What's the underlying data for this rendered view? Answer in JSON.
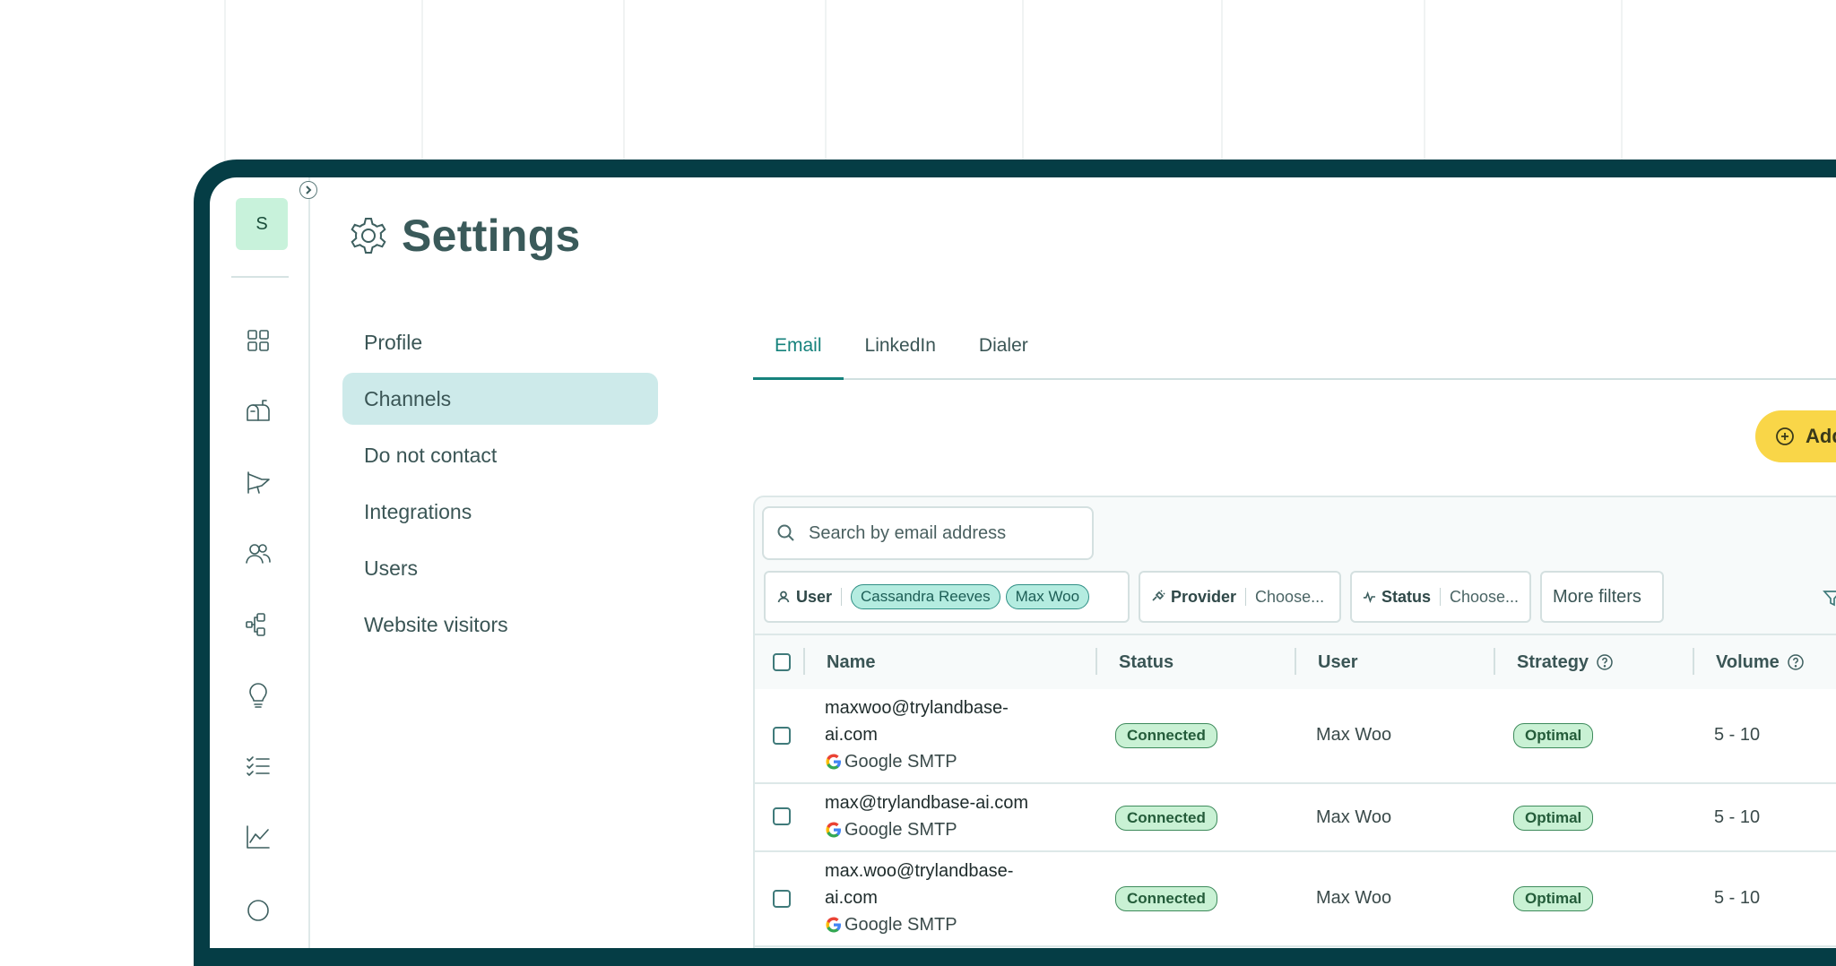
{
  "sidebar": {
    "avatar_initial": "S",
    "collapse_icon": "chevron-right-icon",
    "nav_icons": [
      "dashboard-grid-icon",
      "mailbox-icon",
      "campaign-megaphone-icon",
      "contacts-people-icon",
      "workflow-icon",
      "ideas-lightbulb-icon",
      "tasks-checklist-icon",
      "analytics-chart-icon"
    ]
  },
  "header": {
    "title": "Settings",
    "icon": "gear-icon"
  },
  "settings_menu": {
    "items": [
      {
        "label": "Profile",
        "active": false
      },
      {
        "label": "Channels",
        "active": true
      },
      {
        "label": "Do not contact",
        "active": false
      },
      {
        "label": "Integrations",
        "active": false
      },
      {
        "label": "Users",
        "active": false
      },
      {
        "label": "Website visitors",
        "active": false
      }
    ]
  },
  "tabs": [
    {
      "label": "Email",
      "active": true
    },
    {
      "label": "LinkedIn",
      "active": false
    },
    {
      "label": "Dialer",
      "active": false
    }
  ],
  "add_button": {
    "label": "Add"
  },
  "search": {
    "placeholder": "Search by email address",
    "value": ""
  },
  "filters": {
    "user": {
      "label": "User",
      "chips": [
        "Cassandra Reeves",
        "Max Woo"
      ]
    },
    "provider": {
      "label": "Provider",
      "value": "Choose..."
    },
    "status": {
      "label": "Status",
      "value": "Choose..."
    },
    "more": {
      "label": "More filters"
    }
  },
  "table": {
    "columns": [
      "Name",
      "Status",
      "User",
      "Strategy",
      "Volume"
    ],
    "rows": [
      {
        "email_line1": "maxwoo@trylandbase-",
        "email_line2": "ai.com",
        "provider": "Google SMTP",
        "status": "Connected",
        "user": "Max Woo",
        "strategy": "Optimal",
        "volume": "5 - 10"
      },
      {
        "email_line1": "max@trylandbase-ai.com",
        "email_line2": "",
        "provider": "Google SMTP",
        "status": "Connected",
        "user": "Max Woo",
        "strategy": "Optimal",
        "volume": "5 - 10"
      },
      {
        "email_line1": "max.woo@trylandbase-",
        "email_line2": "ai.com",
        "provider": "Google SMTP",
        "status": "Connected",
        "user": "Max Woo",
        "strategy": "Optimal",
        "volume": "5 - 10"
      }
    ]
  },
  "colors": {
    "device_frame": "#053d45",
    "accent": "#16827c",
    "active_menu_bg": "#cdeaea",
    "add_button": "#f9d648",
    "badge_bg": "#c9f1d4",
    "chip_bg": "#b4ece0"
  }
}
